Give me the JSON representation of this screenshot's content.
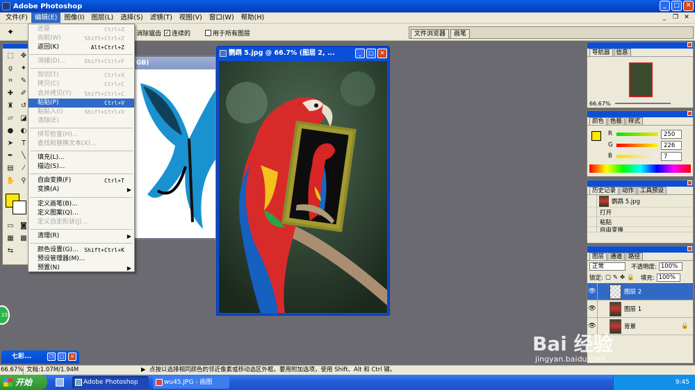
{
  "app": {
    "title": "Adobe Photoshop"
  },
  "menubar": [
    "文件(F)",
    "编辑(E)",
    "图像(I)",
    "图层(L)",
    "选择(S)",
    "滤镜(T)",
    "视图(V)",
    "窗口(W)",
    "帮助(H)"
  ],
  "options": {
    "anti_alias": "消除锯齿",
    "contiguous": "连续的",
    "all_layers": "用于所有图层"
  },
  "palette_well": [
    "文件浏览器",
    "画笔"
  ],
  "bg_doc": {
    "title": "GB)"
  },
  "active_doc": {
    "title": "鹦鹉 5.jpg @ 66.7% (图层 2, ..."
  },
  "edit_menu": {
    "items": [
      {
        "label": "还原",
        "shortcut": "Ctrl+Z",
        "disabled": true
      },
      {
        "label": "向前(W)",
        "shortcut": "Shift+Ctrl+Z",
        "disabled": true
      },
      {
        "label": "返回(K)",
        "shortcut": "Alt+Ctrl+Z",
        "disabled": false
      },
      {
        "sep": true
      },
      {
        "label": "消褪(D)...",
        "shortcut": "Shift+Ctrl+F",
        "disabled": true
      },
      {
        "sep": true
      },
      {
        "label": "剪切(T)",
        "shortcut": "Ctrl+X",
        "disabled": true
      },
      {
        "label": "拷贝(C)",
        "shortcut": "Ctrl+C",
        "disabled": true
      },
      {
        "label": "合并拷贝(Y)",
        "shortcut": "Shift+Ctrl+C",
        "disabled": true
      },
      {
        "label": "粘贴(P)",
        "shortcut": "Ctrl+V",
        "disabled": false,
        "highlight": true
      },
      {
        "label": "粘贴入(I)",
        "shortcut": "Shift+Ctrl+V",
        "disabled": true
      },
      {
        "label": "清除(E)",
        "shortcut": "",
        "disabled": true
      },
      {
        "sep": true
      },
      {
        "label": "拼写检查(H)...",
        "shortcut": "",
        "disabled": true
      },
      {
        "label": "查找和替换文本(X)...",
        "shortcut": "",
        "disabled": true
      },
      {
        "sep": true
      },
      {
        "label": "填充(L)...",
        "shortcut": "",
        "disabled": false
      },
      {
        "label": "描边(S)...",
        "shortcut": "",
        "disabled": false
      },
      {
        "sep": true
      },
      {
        "label": "自由变换(F)",
        "shortcut": "Ctrl+T",
        "disabled": false
      },
      {
        "label": "变换(A)",
        "shortcut": "",
        "disabled": false,
        "submenu": true
      },
      {
        "sep": true
      },
      {
        "label": "定义画笔(B)...",
        "shortcut": "",
        "disabled": false
      },
      {
        "label": "定义图案(Q)...",
        "shortcut": "",
        "disabled": false
      },
      {
        "label": "定义自定形状(J)...",
        "shortcut": "",
        "disabled": true
      },
      {
        "sep": true
      },
      {
        "label": "清理(R)",
        "shortcut": "",
        "disabled": false,
        "submenu": true
      },
      {
        "sep": true
      },
      {
        "label": "颜色设置(G)...",
        "shortcut": "Shift+Ctrl+K",
        "disabled": false
      },
      {
        "label": "预设管理器(M)...",
        "shortcut": "",
        "disabled": false
      },
      {
        "label": "预置(N)",
        "shortcut": "",
        "disabled": false,
        "submenu": true
      }
    ]
  },
  "navigator": {
    "tabs": [
      "导航器",
      "信息"
    ],
    "zoom": "66.67%"
  },
  "color_panel": {
    "tabs": [
      "颜色",
      "色板",
      "样式"
    ],
    "r": "250",
    "g": "226",
    "b": "7",
    "fg_color": "#fbe70a"
  },
  "history_panel": {
    "tabs": [
      "历史记录",
      "动作",
      "工具预设"
    ],
    "snapshot": "鹦鹉 5.jpg",
    "steps": [
      "打开",
      "粘贴",
      "自由变换"
    ]
  },
  "layers_panel": {
    "tabs": [
      "图层",
      "通道",
      "路径"
    ],
    "blend_mode": "正常",
    "opacity_label": "不透明度:",
    "opacity": "100%",
    "lock_label": "锁定:",
    "fill_label": "填充:",
    "fill": "100%",
    "layers": [
      {
        "name": "图层 2",
        "selected": true
      },
      {
        "name": "图层 1",
        "selected": false
      },
      {
        "name": "背景",
        "selected": false
      }
    ]
  },
  "minimized_window": "七彩...",
  "statusbar": {
    "zoom": "66.67%",
    "doc": "文档:1.07M/1.94M",
    "hint": "点按以选择相同颜色的邻近像素或移动选区外框。要用附加选项，使用 Shift、Alt 和 Ctrl 键。"
  },
  "taskbar": {
    "start": "开始",
    "tasks": [
      "Adobe Photoshop",
      "wu45.JPG - 画图"
    ],
    "time": "9:45"
  },
  "watermark": {
    "brand": "Bai 经验",
    "url": "jingyan.baidu.com"
  },
  "badge": "23"
}
